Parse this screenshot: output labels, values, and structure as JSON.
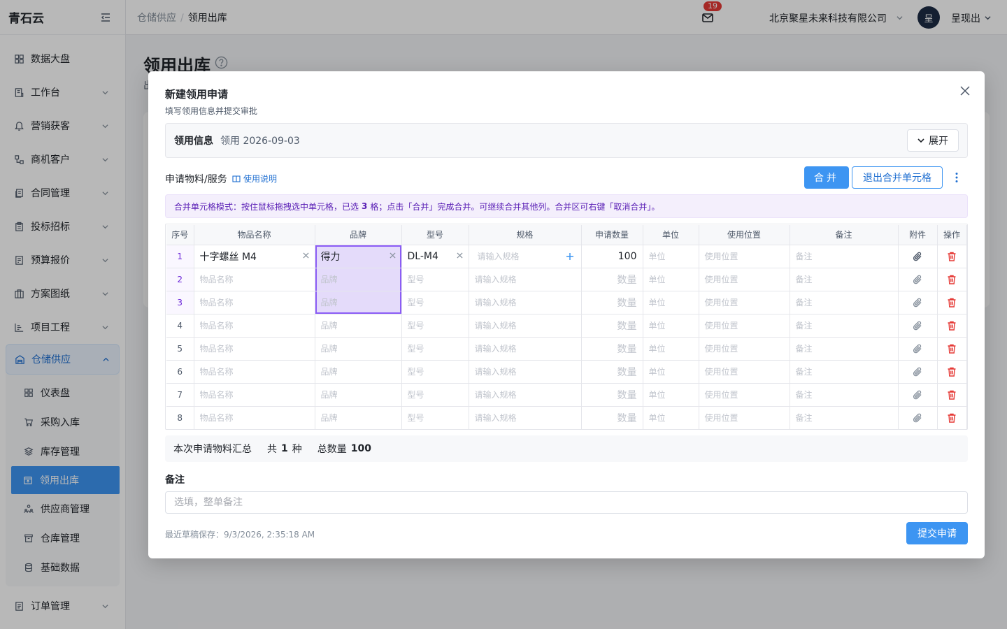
{
  "app": {
    "logo": "青石云"
  },
  "sidebar": {
    "items": [
      {
        "label": "数据大盘",
        "icon": "dashboard-icon"
      },
      {
        "label": "工作台",
        "icon": "workbench-icon"
      },
      {
        "label": "营销获客",
        "icon": "marketing-icon"
      },
      {
        "label": "商机客户",
        "icon": "customer-icon"
      },
      {
        "label": "合同管理",
        "icon": "contract-icon"
      },
      {
        "label": "投标招标",
        "icon": "bid-icon"
      },
      {
        "label": "预算报价",
        "icon": "budget-icon"
      },
      {
        "label": "方案图纸",
        "icon": "drawing-icon"
      },
      {
        "label": "项目工程",
        "icon": "project-icon"
      }
    ],
    "group": {
      "label": "仓储供应",
      "icon": "warehouse-icon",
      "children": [
        {
          "label": "仪表盘",
          "icon": "dashboard-icon"
        },
        {
          "label": "采购入库",
          "icon": "cart-icon"
        },
        {
          "label": "库存管理",
          "icon": "layers-icon"
        },
        {
          "label": "领用出库",
          "icon": "outbound-icon",
          "active": true
        },
        {
          "label": "供应商管理",
          "icon": "supplier-icon"
        },
        {
          "label": "仓库管理",
          "icon": "box-icon"
        },
        {
          "label": "基础数据",
          "icon": "database-icon"
        }
      ]
    },
    "after": [
      {
        "label": "订单管理",
        "icon": "order-icon"
      }
    ]
  },
  "topbar": {
    "breadcrumb": [
      "仓储供应",
      "领用出库"
    ],
    "mail_count": "19",
    "company": "北京聚星未来科技有限公司",
    "avatar_text": "呈",
    "user": "呈现出"
  },
  "page": {
    "title": "领用出库",
    "subtitle": "出"
  },
  "modal": {
    "title": "新建领用申请",
    "subtitle": "填写领用信息并提交审批",
    "info_label": "领用信息",
    "info_value": "领用 2026-09-03",
    "expand_label": "展开",
    "section_label": "申请物料/服务",
    "help_link": "使用说明",
    "merge_button": "合并",
    "exit_merge_button": "退出合并单元格",
    "tip_before": "合并单元格模式：按住鼠标拖拽选中单元格，已选",
    "tip_count": "3",
    "tip_after": "格；点击「合并」完成合并。可继续合并其他列。合并区可右键「取消合并」。",
    "columns": [
      "序号",
      "物品名称",
      "品牌",
      "型号",
      "规格",
      "申请数量",
      "单位",
      "使用位置",
      "备注",
      "附件",
      "操作"
    ],
    "placeholders": {
      "name": "物品名称",
      "brand": "品牌",
      "model": "型号",
      "spec": "请输入规格",
      "qty": "数量",
      "unit": "单位",
      "location": "使用位置",
      "remark": "备注"
    },
    "rows": [
      {
        "idx": "1",
        "name": "十字螺丝 M4",
        "brand": "得力",
        "model": "DL-M4",
        "qty": "100"
      },
      {
        "idx": "2"
      },
      {
        "idx": "3"
      },
      {
        "idx": "4"
      },
      {
        "idx": "5"
      },
      {
        "idx": "6"
      },
      {
        "idx": "7"
      },
      {
        "idx": "8"
      }
    ],
    "summary": {
      "label": "本次申请物料汇总",
      "kinds_prefix": "共",
      "kinds": "1",
      "kinds_suffix": "种",
      "total_label": "总数量",
      "total": "100"
    },
    "note_label": "备注",
    "note_placeholder": "选填，整单备注",
    "draft_saved": "最近草稿保存：9/3/2026, 2:35:18 AM",
    "submit": "提交申请"
  },
  "colors": {
    "primary": "#3d95f2",
    "merge_purple": "#8b5cf6",
    "danger": "#e53935"
  }
}
